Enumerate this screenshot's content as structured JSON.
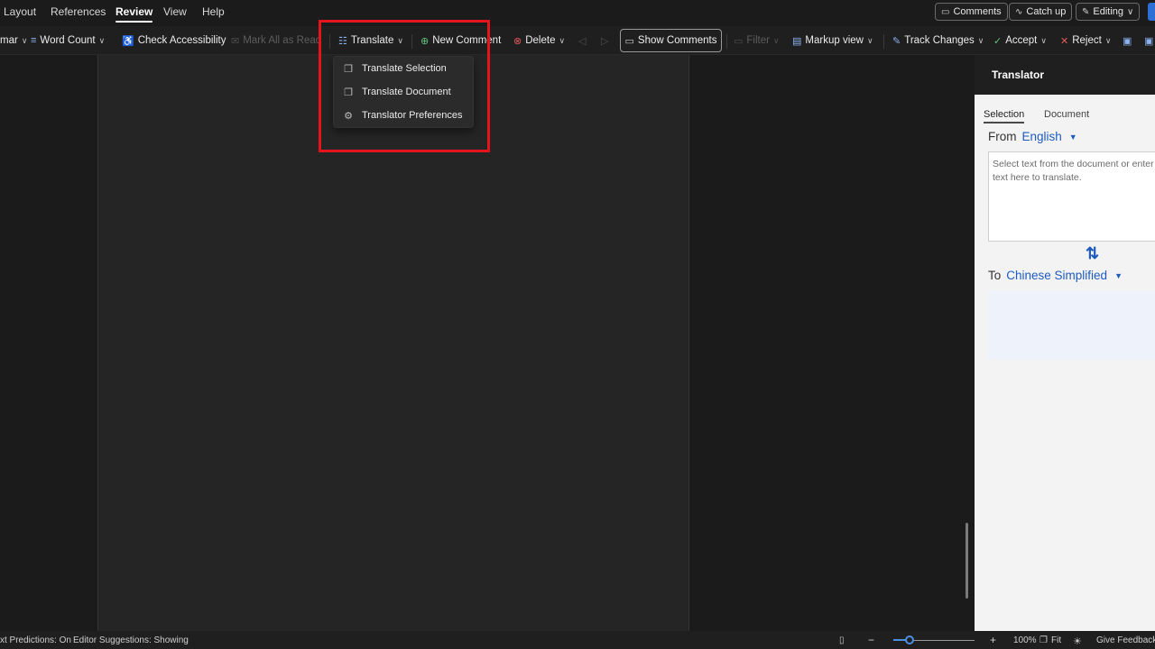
{
  "menubar": {
    "tabs": [
      {
        "label": "Layout"
      },
      {
        "label": "References"
      },
      {
        "label": "Review"
      },
      {
        "label": "View"
      },
      {
        "label": "Help"
      }
    ],
    "comments_label": "Comments",
    "catchup_label": "Catch up",
    "editing_label": "Editing"
  },
  "ribbon": {
    "grammar_partial": "mar",
    "word_count": "Word Count",
    "check_accessibility": "Check Accessibility",
    "mark_all_as_read": "Mark All as Read",
    "translate": "Translate",
    "new_comment": "New Comment",
    "delete": "Delete",
    "show_comments": "Show Comments",
    "filter": "Filter",
    "markup_view": "Markup view",
    "track_changes": "Track Changes",
    "accept": "Accept",
    "reject": "Reject"
  },
  "translate_menu": {
    "items": [
      {
        "label": "Translate Selection",
        "icon": "translate-selection-icon"
      },
      {
        "label": "Translate Document",
        "icon": "translate-document-icon"
      },
      {
        "label": "Translator Preferences",
        "icon": "settings-gear-icon"
      }
    ]
  },
  "translator_pane": {
    "title": "Translator",
    "tabs": [
      {
        "label": "Selection"
      },
      {
        "label": "Document"
      }
    ],
    "from_label": "From",
    "from_language": "English",
    "source_placeholder": "Select text from the document or enter text here to translate.",
    "to_label": "To",
    "to_language": "Chinese Simplified"
  },
  "statusbar": {
    "text_predictions": "xt Predictions: On",
    "editor_suggestions": "Editor Suggestions: Showing",
    "zoom_level": "100%",
    "zoom_fraction": 0.2,
    "fit_label": "Fit",
    "feedback": "Give Feedback"
  },
  "colors": {
    "accent_blue": "#1e5bbf",
    "highlight_red": "#e3141b",
    "background": "#1b1b1b"
  }
}
